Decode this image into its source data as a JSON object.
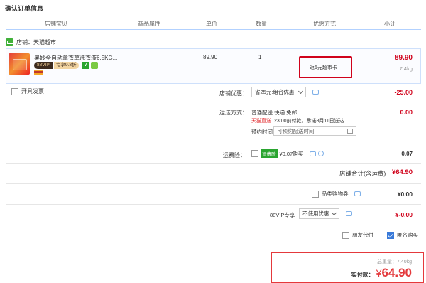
{
  "page": {
    "title": "确认订单信息"
  },
  "table_header": {
    "shop_item": "店铺宝贝",
    "attrs": "商品属性",
    "unit_price": "单价",
    "quantity": "数量",
    "discount": "优惠方式",
    "subtotal": "小计"
  },
  "shop": {
    "label": "店铺：天猫超市"
  },
  "item": {
    "name": "奥妙全自动薰衣草洗衣液6.5KG...",
    "vip_label": "88VIP",
    "vip_price": "专享9.8折",
    "tag_7": "7",
    "price": "89.90",
    "quantity": "1",
    "promo": "返5元超市卡",
    "subtotal": "89.90",
    "weight": "7.4kg"
  },
  "invoice": {
    "label": "开具发票"
  },
  "shop_discount": {
    "label": "店铺优惠：",
    "selected": "省25元:组合优惠",
    "amount": "-25.00"
  },
  "delivery": {
    "label": "运送方式：",
    "method": "普通配送 快递 免邮",
    "tmall_label": "天猫直送",
    "promise": "23:00前付款，承诺8月11日送达",
    "schedule_label": "预约时间",
    "schedule_placeholder": "可预约配送时间",
    "amount": "0.00"
  },
  "freight_insurance": {
    "label": "运费险：",
    "tag": "运费险",
    "text": "¥0.07购买",
    "amount": "0.07"
  },
  "shop_total": {
    "label": "店铺合计(含运费)",
    "amount": "¥64.90"
  },
  "coupon": {
    "label": "品类购物券",
    "amount": "¥0.00"
  },
  "vip": {
    "label": "88VIP专享",
    "selected": "不使用优惠",
    "amount": "¥-0.00"
  },
  "options": {
    "friend_pay": "朋友代付",
    "anonymous": "匿名购买"
  },
  "summary": {
    "weight_label": "总重量：",
    "weight": "7.40kg",
    "pay_label": "实付款：",
    "currency": "¥",
    "amount": "64.90"
  },
  "colors": {
    "accent_red": "#d0021b",
    "header_line": "#b2d1ff",
    "tmall_red": "#e4393c"
  }
}
